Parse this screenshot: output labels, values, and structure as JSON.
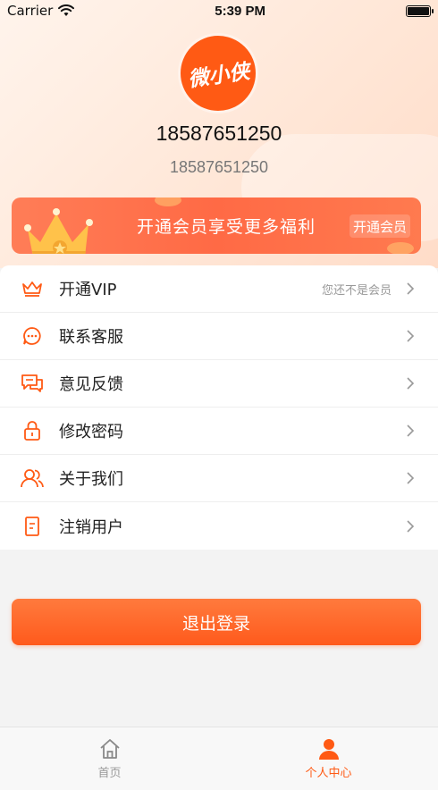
{
  "status_bar": {
    "carrier": "Carrier",
    "time": "5:39 PM"
  },
  "profile": {
    "logo_text": "微小侠",
    "username": "18587651250",
    "phone": "18587651250"
  },
  "vip_banner": {
    "promo_text": "开通会员享受更多福利",
    "button_label": "开通会员"
  },
  "menu": {
    "items": [
      {
        "label": "开通VIP",
        "hint": "您还不是会员",
        "icon": "crown-icon"
      },
      {
        "label": "联系客服",
        "hint": "",
        "icon": "chat-icon"
      },
      {
        "label": "意见反馈",
        "hint": "",
        "icon": "feedback-icon"
      },
      {
        "label": "修改密码",
        "hint": "",
        "icon": "lock-icon"
      },
      {
        "label": "关于我们",
        "hint": "",
        "icon": "users-icon"
      },
      {
        "label": "注销用户",
        "hint": "",
        "icon": "document-icon"
      }
    ]
  },
  "logout": {
    "label": "退出登录"
  },
  "tabbar": {
    "tabs": [
      {
        "label": "首页",
        "icon": "home-icon",
        "active": false
      },
      {
        "label": "个人中心",
        "icon": "person-icon",
        "active": true
      }
    ]
  },
  "colors": {
    "accent": "#ff5a14",
    "banner": "#ff6a45",
    "inactive_tab": "#999999"
  }
}
